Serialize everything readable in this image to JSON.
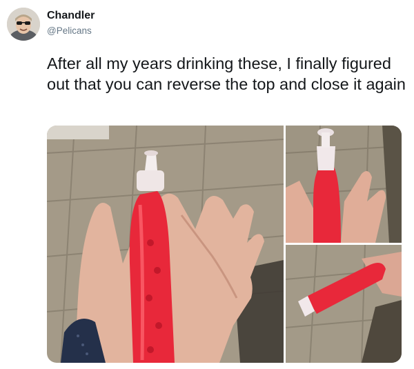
{
  "author": {
    "display_name": "Chandler",
    "handle": "@Pelicans"
  },
  "tweet": {
    "text": "After all my years drinking these, I finally figured out that you can reverse the top and close it again"
  },
  "media": {
    "count": 3,
    "items": [
      {
        "icon": "photo-hand-holding-red-drink-bottle"
      },
      {
        "icon": "photo-hand-holding-bottle-top-up"
      },
      {
        "icon": "photo-hand-holding-bottle-sideways"
      }
    ]
  },
  "colors": {
    "text": "#14171a",
    "secondary": "#657786",
    "drink_red": "#e8283a"
  }
}
